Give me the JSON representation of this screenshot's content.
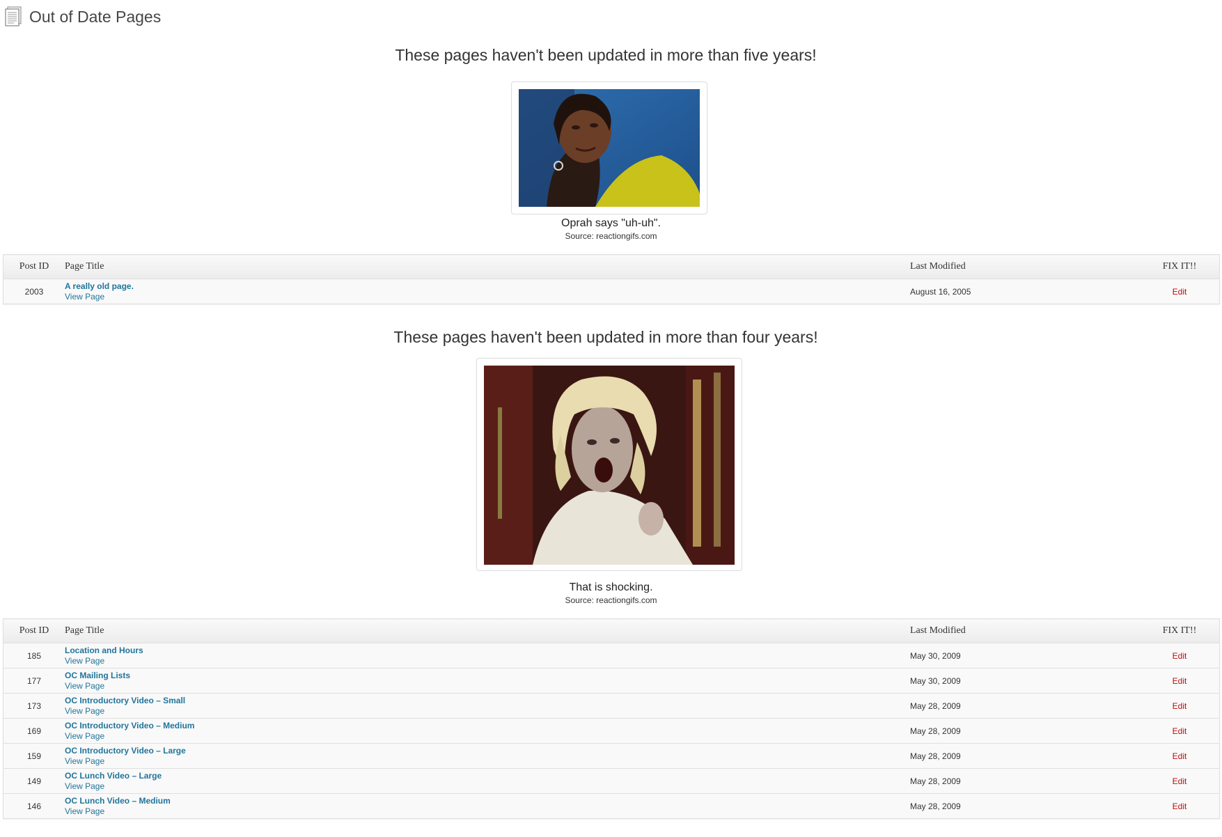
{
  "page": {
    "title": "Out of Date Pages",
    "icon": "pages-icon"
  },
  "table_headers": {
    "post_id": "Post ID",
    "page_title": "Page Title",
    "last_modified": "Last Modified",
    "fix_it": "FIX IT!!"
  },
  "sections": [
    {
      "heading": "These pages haven't been updated in more than five years!",
      "caption": "Oprah says \"uh-uh\".",
      "source": "Source: reactiongifs.com",
      "rows": [
        {
          "id": "2003",
          "title": "A really old page.",
          "view": "View Page",
          "date": "August 16, 2005",
          "edit": "Edit"
        }
      ]
    },
    {
      "heading": "These pages haven't been updated in more than four years!",
      "caption": "That is shocking.",
      "source": "Source: reactiongifs.com",
      "rows": [
        {
          "id": "185",
          "title": "Location and Hours",
          "view": "View Page",
          "date": "May 30, 2009",
          "edit": "Edit"
        },
        {
          "id": "177",
          "title": "OC Mailing Lists",
          "view": "View Page",
          "date": "May 30, 2009",
          "edit": "Edit"
        },
        {
          "id": "173",
          "title": "OC Introductory Video – Small",
          "view": "View Page",
          "date": "May 28, 2009",
          "edit": "Edit"
        },
        {
          "id": "169",
          "title": "OC Introductory Video – Medium",
          "view": "View Page",
          "date": "May 28, 2009",
          "edit": "Edit"
        },
        {
          "id": "159",
          "title": "OC Introductory Video – Large",
          "view": "View Page",
          "date": "May 28, 2009",
          "edit": "Edit"
        },
        {
          "id": "149",
          "title": "OC Lunch Video – Large",
          "view": "View Page",
          "date": "May 28, 2009",
          "edit": "Edit"
        },
        {
          "id": "146",
          "title": "OC Lunch Video – Medium",
          "view": "View Page",
          "date": "May 28, 2009",
          "edit": "Edit"
        }
      ]
    }
  ],
  "colors": {
    "link": "#21759b",
    "edit": "#bc0b0b",
    "border": "#dfdfdf"
  }
}
